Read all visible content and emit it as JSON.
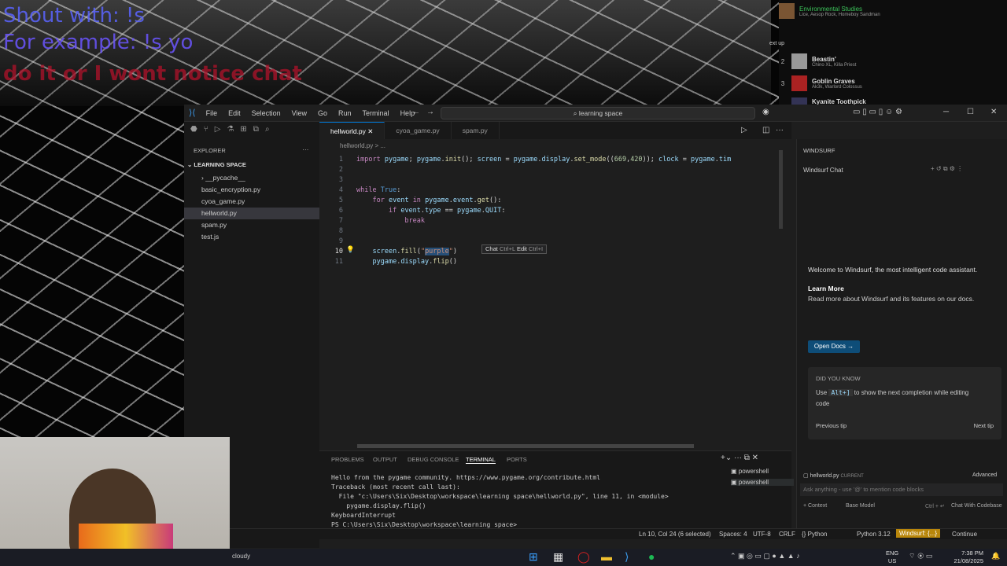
{
  "overlay": {
    "line1": "Shout with: !s",
    "line2": "For example: !s yo",
    "line3": "do it or I wont notice chat"
  },
  "spotify": {
    "current": {
      "title": "Environmental Studies",
      "artist": "Lice, Aesop Rock, Homeboy Sandman"
    },
    "next_label": "ext up",
    "queue": [
      {
        "n": "2",
        "title": "Beastin'",
        "artist": "Chino XL, Killa Priest"
      },
      {
        "n": "3",
        "title": "Goblin Graves",
        "artist": "Ak3k, Warlord Colossus"
      },
      {
        "n": "",
        "title": "Kyanite Toothpick",
        "artist": ""
      }
    ]
  },
  "vscode": {
    "menu": [
      "File",
      "Edit",
      "Selection",
      "View",
      "Go",
      "Run",
      "Terminal",
      "Help"
    ],
    "search": "learning space",
    "explorer": {
      "title": "EXPLORER",
      "folder": "LEARNING SPACE",
      "items": [
        "__pycache__",
        "basic_encryption.py",
        "cyoa_game.py",
        "hellworld.py",
        "spam.py",
        "test.js"
      ]
    },
    "tabs": [
      "hellworld.py",
      "cyoa_game.py",
      "spam.py"
    ],
    "breadcrumb": "hellworld.py > ...",
    "line_numbers": [
      "1",
      "2",
      "3",
      "4",
      "5",
      "6",
      "7",
      "8",
      "9",
      "10",
      "11"
    ],
    "hint": {
      "chat": "Chat",
      "chat_key": "Ctrl+L",
      "edit": "Edit",
      "edit_key": "Ctrl+I"
    },
    "panel_tabs": [
      "PROBLEMS",
      "OUTPUT",
      "DEBUG CONSOLE",
      "TERMINAL",
      "PORTS"
    ],
    "terminal": "Hello from the pygame community. https://www.pygame.org/contribute.html\nTraceback (most recent call last):\n  File \"c:\\Users\\Six\\Desktop\\workspace\\learning space\\hellworld.py\", line 11, in <module>\n    pygame.display.flip()\nKeyboardInterrupt\nPS C:\\Users\\Six\\Desktop\\workspace\\learning space> ",
    "shells": [
      "powershell",
      "powershell"
    ],
    "status": [
      "Ln 10, Col 24 (6 selected)",
      "Spaces: 4",
      "UTF-8",
      "CRLF",
      "{} Python",
      "Python 3.12",
      "Windsurf: {...}",
      "Continue"
    ]
  },
  "windsurf": {
    "header": "WINDSURF",
    "chat_title": "Windsurf Chat",
    "welcome": "Welcome to Windsurf, the most intelligent code assistant.",
    "learn_title": "Learn More",
    "learn_text": "Read more about Windsurf and its features on our docs.",
    "docs_button": "Open Docs",
    "dyk_title": "DID YOU KNOW",
    "dyk_use": "Use",
    "dyk_key": "Alt+]",
    "dyk_text": "to show the next completion while editing code",
    "prev": "Previous tip",
    "next": "Next tip",
    "context_file": "hellworld.py",
    "context_tag": "CURRENT",
    "advanced": "Advanced",
    "input_placeholder": "Ask anything - use '@' to mention code blocks",
    "footer": [
      "+ Context",
      "Base Model",
      "Ctrl + ↵",
      "Chat With Codebase"
    ]
  },
  "taskbar": {
    "weather": "cloudy",
    "lang1": "ENG",
    "lang2": "US",
    "time": "7:38 PM",
    "date": "21/08/2025"
  }
}
